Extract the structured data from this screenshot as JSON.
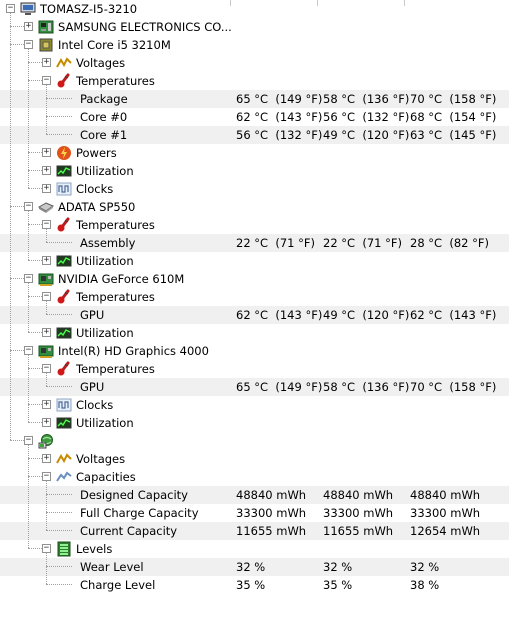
{
  "columns": {
    "x_value": 236,
    "x_min": 323,
    "x_max": 410
  },
  "nodes": [
    {
      "level": 0,
      "label": "TOMASZ-I5-3210",
      "icon": "computer-icon",
      "expander": "minus",
      "name": "tree-node-computer"
    },
    {
      "level": 1,
      "label": "SAMSUNG ELECTRONICS CO...",
      "icon": "motherboard-icon",
      "expander": "plus",
      "name": "tree-node-motherboard"
    },
    {
      "level": 1,
      "label": "Intel Core i5 3210M",
      "icon": "cpu-chip-icon",
      "expander": "minus",
      "name": "tree-node-cpu"
    },
    {
      "level": 2,
      "label": "Voltages",
      "icon": "voltage-icon",
      "expander": "plus",
      "name": "tree-node-cpu-voltages"
    },
    {
      "level": 2,
      "label": "Temperatures",
      "icon": "thermometer-icon",
      "expander": "minus",
      "name": "tree-node-cpu-temperatures"
    },
    {
      "level": 3,
      "label": "Package",
      "values": [
        "65 °C  (149 °F)",
        "58 °C  (136 °F)",
        "70 °C  (158 °F)"
      ],
      "shade": true,
      "name": "sensor-row-package"
    },
    {
      "level": 3,
      "label": "Core #0",
      "values": [
        "62 °C  (143 °F)",
        "56 °C  (132 °F)",
        "68 °C  (154 °F)"
      ],
      "shade": false,
      "name": "sensor-row-core0"
    },
    {
      "level": 3,
      "label": "Core #1",
      "values": [
        "56 °C  (132 °F)",
        "49 °C  (120 °F)",
        "63 °C  (145 °F)"
      ],
      "shade": true,
      "name": "sensor-row-core1"
    },
    {
      "level": 2,
      "label": "Powers",
      "icon": "power-icon",
      "expander": "plus",
      "name": "tree-node-cpu-powers"
    },
    {
      "level": 2,
      "label": "Utilization",
      "icon": "utilization-icon",
      "expander": "plus",
      "name": "tree-node-cpu-utilization"
    },
    {
      "level": 2,
      "label": "Clocks",
      "icon": "clock-wave-icon",
      "expander": "plus",
      "name": "tree-node-cpu-clocks"
    },
    {
      "level": 1,
      "label": "ADATA SP550",
      "icon": "disk-icon",
      "expander": "minus",
      "name": "tree-node-ssd"
    },
    {
      "level": 2,
      "label": "Temperatures",
      "icon": "thermometer-icon",
      "expander": "minus",
      "name": "tree-node-ssd-temperatures"
    },
    {
      "level": 3,
      "label": "Assembly",
      "values": [
        "22 °C  (71 °F)",
        "22 °C  (71 °F)",
        "28 °C  (82 °F)"
      ],
      "shade": true,
      "name": "sensor-row-assembly"
    },
    {
      "level": 2,
      "label": "Utilization",
      "icon": "utilization-icon",
      "expander": "plus",
      "name": "tree-node-ssd-utilization"
    },
    {
      "level": 1,
      "label": "NVIDIA GeForce 610M",
      "icon": "gpu-card-icon",
      "expander": "minus",
      "name": "tree-node-nvidia"
    },
    {
      "level": 2,
      "label": "Temperatures",
      "icon": "thermometer-icon",
      "expander": "minus",
      "name": "tree-node-nvidia-temperatures"
    },
    {
      "level": 3,
      "label": "GPU",
      "values": [
        "62 °C  (143 °F)",
        "49 °C  (120 °F)",
        "62 °C  (143 °F)"
      ],
      "shade": true,
      "name": "sensor-row-nvidia-gpu"
    },
    {
      "level": 2,
      "label": "Utilization",
      "icon": "utilization-icon",
      "expander": "plus",
      "name": "tree-node-nvidia-utilization"
    },
    {
      "level": 1,
      "label": "Intel(R) HD Graphics 4000",
      "icon": "gpu-card-icon",
      "expander": "minus",
      "name": "tree-node-intel-gpu"
    },
    {
      "level": 2,
      "label": "Temperatures",
      "icon": "thermometer-icon",
      "expander": "minus",
      "name": "tree-node-intel-temperatures"
    },
    {
      "level": 3,
      "label": "GPU",
      "values": [
        "65 °C  (149 °F)",
        "58 °C  (136 °F)",
        "70 °C  (158 °F)"
      ],
      "shade": true,
      "name": "sensor-row-intel-gpu"
    },
    {
      "level": 2,
      "label": "Clocks",
      "icon": "clock-wave-icon",
      "expander": "plus",
      "name": "tree-node-intel-clocks"
    },
    {
      "level": 2,
      "label": "Utilization",
      "icon": "utilization-icon",
      "expander": "plus",
      "name": "tree-node-intel-utilization"
    },
    {
      "level": 1,
      "label": "",
      "icon": "battery-globe-icon",
      "expander": "minus",
      "name": "tree-node-battery"
    },
    {
      "level": 2,
      "label": "Voltages",
      "icon": "voltage-icon",
      "expander": "plus",
      "name": "tree-node-battery-voltages"
    },
    {
      "level": 2,
      "label": "Capacities",
      "icon": "capacity-icon",
      "expander": "minus",
      "name": "tree-node-battery-capacities"
    },
    {
      "level": 3,
      "label": "Designed Capacity",
      "values": [
        "48840 mWh",
        "48840 mWh",
        "48840 mWh"
      ],
      "shade": true,
      "name": "sensor-row-designed-capacity"
    },
    {
      "level": 3,
      "label": "Full Charge Capacity",
      "values": [
        "33300 mWh",
        "33300 mWh",
        "33300 mWh"
      ],
      "shade": false,
      "name": "sensor-row-full-charge-capacity"
    },
    {
      "level": 3,
      "label": "Current Capacity",
      "values": [
        "11655 mWh",
        "11655 mWh",
        "12654 mWh"
      ],
      "shade": true,
      "name": "sensor-row-current-capacity"
    },
    {
      "level": 2,
      "label": "Levels",
      "icon": "levels-icon",
      "expander": "minus",
      "name": "tree-node-battery-levels"
    },
    {
      "level": 3,
      "label": "Wear Level",
      "values": [
        "32 %",
        "32 %",
        "32 %"
      ],
      "shade": true,
      "name": "sensor-row-wear-level"
    },
    {
      "level": 3,
      "label": "Charge Level",
      "values": [
        "35 %",
        "35 %",
        "38 %"
      ],
      "shade": false,
      "name": "sensor-row-charge-level"
    }
  ]
}
